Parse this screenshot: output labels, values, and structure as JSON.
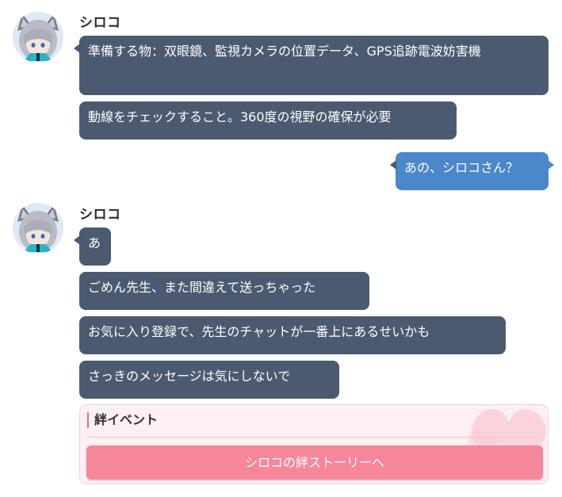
{
  "messages": {
    "group1": {
      "sender": "シロコ",
      "bubbles": [
        "準備する物：双眼鏡、監視カメラの位置データ、GPS追跡電波妨害機",
        "動線をチェックすること。360度の視野の確保が必要"
      ]
    },
    "mine": {
      "text": "あの、シロコさん？"
    },
    "group2": {
      "sender": "シロコ",
      "bubbles": [
        "あ",
        "ごめん先生、また間違えて送っちゃった",
        "お気に入り登録で、先生のチャットが一番上にあるせいかも",
        "さっきのメッセージは気にしないで"
      ]
    }
  },
  "kizuna": {
    "header": "絆イベント",
    "button_label": "シロコの絆ストーリーへ"
  },
  "colors": {
    "other_bubble": "#4b5a70",
    "my_bubble": "#4a88c9",
    "kizuna_button": "#f6879b",
    "kizuna_bg": "#fdf0f3"
  },
  "icons": {
    "avatar": "shiroko-avatar",
    "decor": "heart-icon"
  }
}
